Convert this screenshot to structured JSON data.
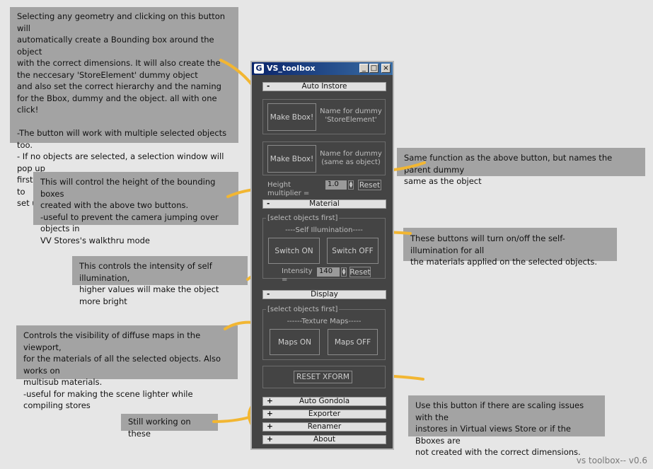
{
  "window": {
    "title": "VS_toolbox",
    "minimize": "_",
    "maximize": "□",
    "close": "×"
  },
  "rollouts": {
    "auto_instore": {
      "sign": "-",
      "label": "Auto Instore"
    },
    "material": {
      "sign": "-",
      "label": "Material"
    },
    "display": {
      "sign": "-",
      "label": "Display"
    },
    "auto_gondola": {
      "sign": "+",
      "label": "Auto Gondola"
    },
    "exporter": {
      "sign": "+",
      "label": "Exporter"
    },
    "renamer": {
      "sign": "+",
      "label": "Renamer"
    },
    "about": {
      "sign": "+",
      "label": "About"
    }
  },
  "auto_instore": {
    "make_bbox_1": "Make Bbox!",
    "name_info_1": "Name for dummy\n'StoreElement'",
    "make_bbox_2": "Make Bbox!",
    "name_info_2": "Name for dummy\n(same as object)",
    "height_label": "Height multiplier =",
    "height_value": "1.0",
    "reset": "Reset"
  },
  "material": {
    "group_title": "[select objects first]",
    "sub_title": "----Self Illumination----",
    "switch_on": "Switch ON",
    "switch_off": "Switch OFF",
    "intensity_label": "Intensity =",
    "intensity_value": "140",
    "reset": "Reset"
  },
  "display": {
    "group_title": "[select objects first]",
    "sub_title": "------Texture Maps-----",
    "maps_on": "Maps ON",
    "maps_off": "Maps OFF",
    "reset_xform": "RESET XFORM"
  },
  "notes": {
    "bbox": "Selecting any geometry and clicking on this button will\nautomatically create a Bounding box around the object\nwith the correct dimensions. It will also create the\nthe neccesary 'StoreElement' dummy object\nand also set the correct hierarchy and the naming\nfor the Bbox, dummy and the object. all with one click!\n\n-The button will work with multiple selected objects too.\n- If no objects are selected, a selection window will pop up\nfirst allowing you to choose which objects you want to\nset up the bbox and the store element for.",
    "same_function": "Same function as the above button, but names the parent dummy\nsame as the object",
    "height": "This will control the height of the bounding boxes\ncreated with the above two buttons.\n-useful to prevent the camera jumping over objects in\nVV Stores's walkthru mode",
    "self_illum": "These buttons will turn on/off the self-illumination for all\nthe materials applied on the  selected objects.",
    "intensity": "This controls the intensity of self illumination,\nhigher values will make the object more bright",
    "maps": "Controls the visibility of diffuse maps in the viewport,\nfor the materials of all the selected objects. Also works on\nmultisub materials.\n-useful for making the scene lighter while compiling stores",
    "reset_xform": "Use this button if there are scaling issues with the\ninstores in Virtual views Store or if the Bboxes are\nnot created with the correct dimensions.",
    "still_working": "Still working on these"
  },
  "version": "vs toolbox-- v0.6",
  "colors": {
    "arrow": "#f2b632",
    "note_bg": "#a3a3a3",
    "panel_bg": "#444444"
  }
}
